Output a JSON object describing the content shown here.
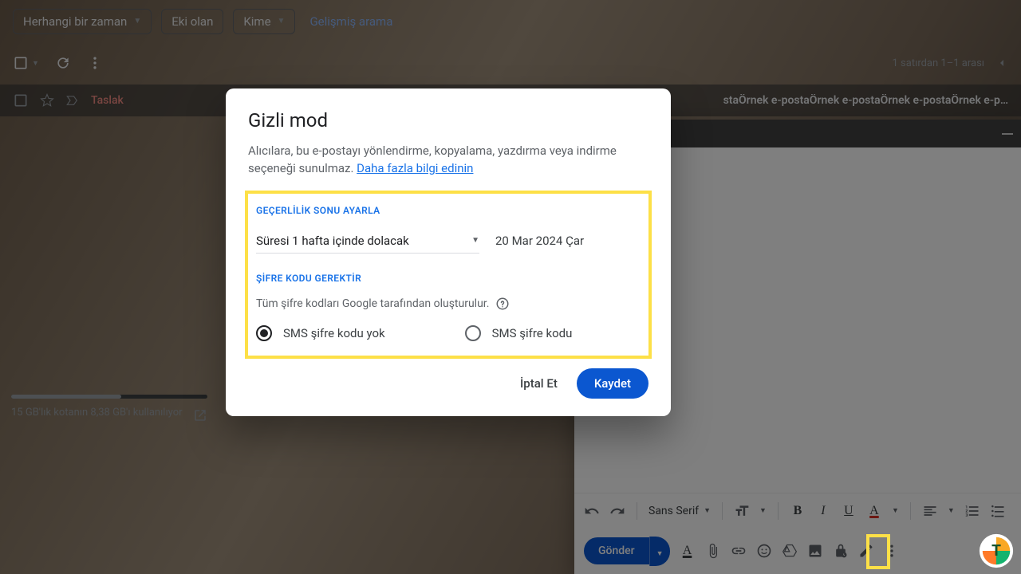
{
  "filters": {
    "anytime": "Herhangi bir zaman",
    "has_attach": "Eki olan",
    "to": "Kime",
    "advanced": "Gelişmiş arama"
  },
  "toolbar": {
    "count_text": "1 satırdan 1–1 arası"
  },
  "row": {
    "draft_label": "Taslak",
    "subject": "staÖrnek e-postaÖrnek e-postaÖrnek e-postaÖrnek e-p…"
  },
  "storage": {
    "text": "15 GB'lık kotanın 8,38 GB'ı kullanılıyor"
  },
  "compose": {
    "font_name": "Sans Serif",
    "send_label": "Gönder"
  },
  "modal": {
    "title": "Gizli mod",
    "desc1": "Alıcılara, bu e-postayı yönlendirme, kopyalama, yazdırma veya indirme seçeneği sunulmaz. ",
    "learn_more": "Daha fazla bilgi edinin",
    "exp_title": "GEÇERLİLİK SONU AYARLA",
    "exp_value": "Süresi 1 hafta içinde dolacak",
    "exp_date": "20 Mar 2024 Çar",
    "pass_title": "ŞİFRE KODU GEREKTİR",
    "pass_desc": "Tüm şifre kodları Google tarafından oluşturulur.",
    "radio_none": "SMS şifre kodu yok",
    "radio_sms": "SMS şifre kodu",
    "cancel": "İptal Et",
    "save": "Kaydet"
  }
}
